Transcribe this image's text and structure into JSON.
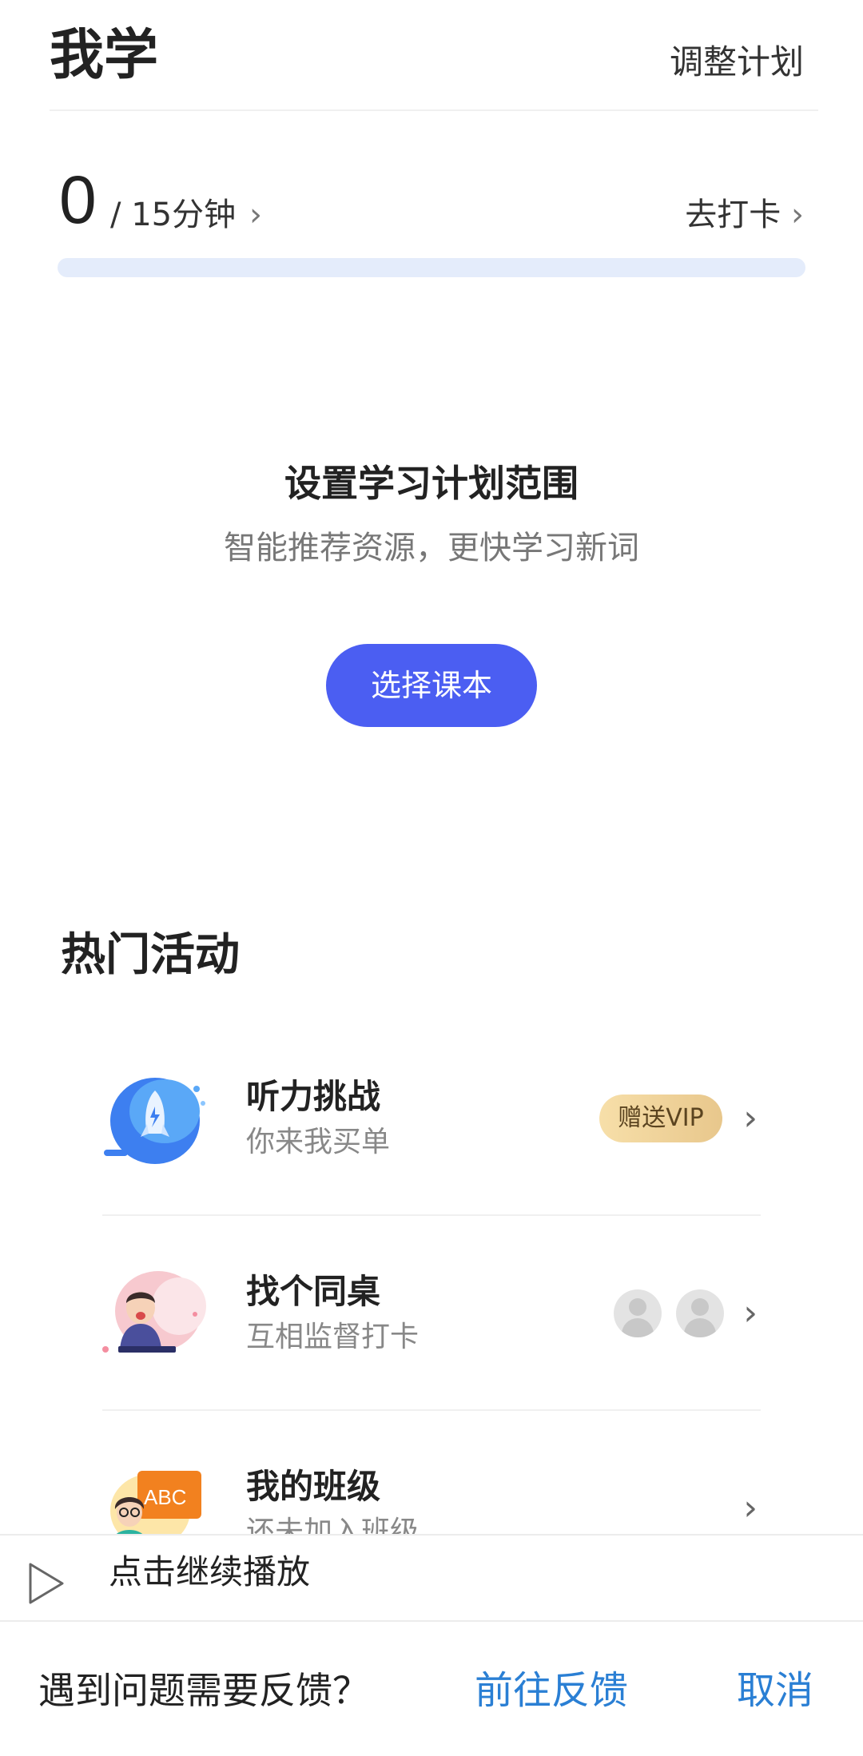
{
  "header": {
    "title": "我学",
    "adjust_plan": "调整计划"
  },
  "progress": {
    "minutes_done": "0",
    "minutes_goal": "/ 15分钟",
    "checkin_link": "去打卡",
    "fraction": 0
  },
  "plan_setup": {
    "title": "设置学习计划范围",
    "subtitle": "智能推荐资源，更快学习新词",
    "choose_book_button": "选择课本"
  },
  "activities": {
    "section_title": "热门活动",
    "items": [
      {
        "title": "听力挑战",
        "subtitle": "你来我买单",
        "badge": "赠送VIP",
        "icon": "rocket-icon"
      },
      {
        "title": "找个同桌",
        "subtitle": "互相监督打卡",
        "icon": "student-icon"
      },
      {
        "title": "我的班级",
        "subtitle": "还未加入班级",
        "icon": "teacher-icon"
      }
    ]
  },
  "play_bar": {
    "text": "点击继续播放",
    "icon": "play-icon"
  },
  "feedback_bar": {
    "prompt": "遇到问题需要反馈？",
    "go_button": "前往反馈",
    "cancel_button": "取消"
  },
  "colors": {
    "accent": "#4b5ef2",
    "progress_track": "#e4ecfb",
    "link_blue": "#2a7fd4",
    "vip_gold": "#e8c78c"
  }
}
